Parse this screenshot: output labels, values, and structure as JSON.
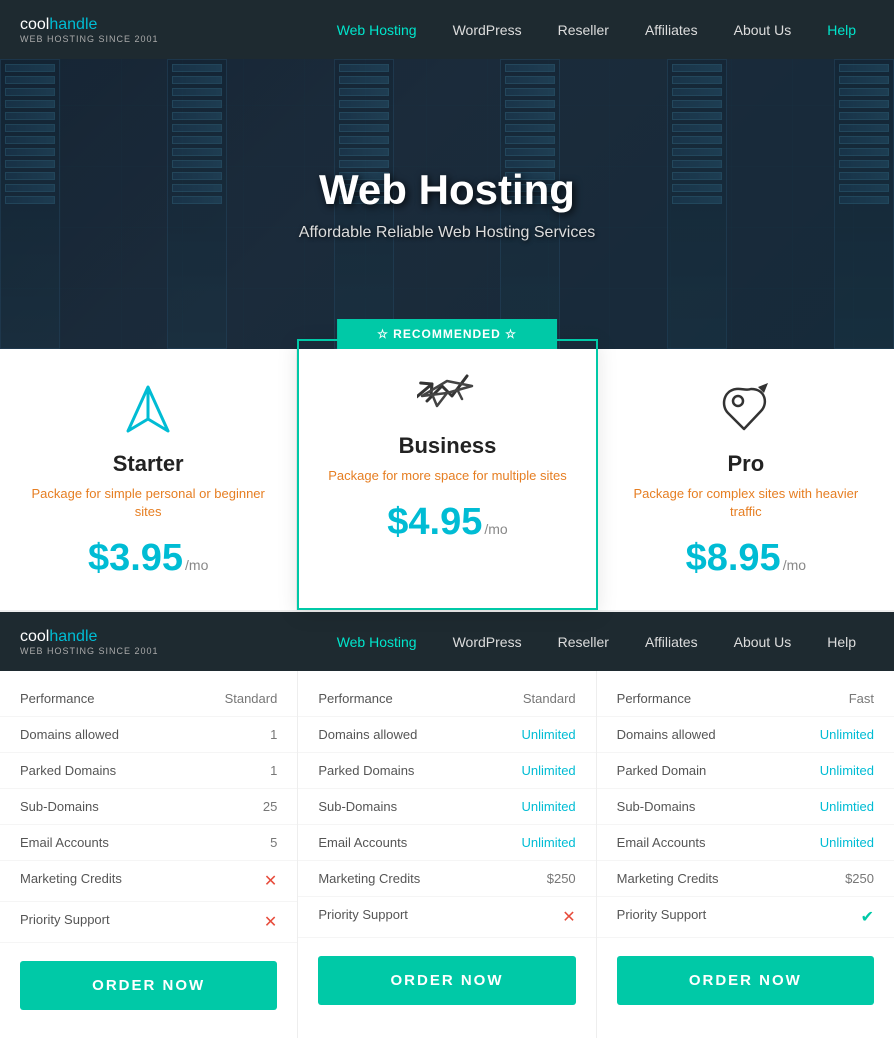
{
  "nav": {
    "logo_cool": "cool",
    "logo_handle": "handle",
    "logo_sub": "WEB HOSTING SINCE 2001",
    "links": [
      {
        "label": "Web Hosting",
        "active": true,
        "help": false
      },
      {
        "label": "WordPress",
        "active": false,
        "help": false
      },
      {
        "label": "Reseller",
        "active": false,
        "help": false
      },
      {
        "label": "Affiliates",
        "active": false,
        "help": false
      },
      {
        "label": "About Us",
        "active": false,
        "help": false
      },
      {
        "label": "Help",
        "active": false,
        "help": true
      }
    ]
  },
  "hero": {
    "title": "Web Hosting",
    "subtitle": "Affordable Reliable Web Hosting Services"
  },
  "recommended_badge": "☆ RECOMMENDED ☆",
  "plans": [
    {
      "id": "starter",
      "name": "Starter",
      "desc": "Package for simple personal\nor beginner sites",
      "price": "$3.95",
      "mo": "/mo",
      "featured": false
    },
    {
      "id": "business",
      "name": "Business",
      "desc": "Package for more space for\nmultiple sites",
      "price": "$4.95",
      "mo": "/mo",
      "featured": true
    },
    {
      "id": "pro",
      "name": "Pro",
      "desc": "Package for complex sites\nwith heavier traffic",
      "price": "$8.95",
      "mo": "/mo",
      "featured": false
    }
  ],
  "features": {
    "starter": [
      {
        "label": "Performance",
        "value": "Standard",
        "type": "normal"
      },
      {
        "label": "Domains allowed",
        "value": "1",
        "type": "normal"
      },
      {
        "label": "Parked Domains",
        "value": "1",
        "type": "normal"
      },
      {
        "label": "Sub-Domains",
        "value": "25",
        "type": "normal"
      },
      {
        "label": "Email Accounts",
        "value": "5",
        "type": "normal"
      },
      {
        "label": "Marketing Credits",
        "value": "✕",
        "type": "cross"
      },
      {
        "label": "Priority Support",
        "value": "✕",
        "type": "cross"
      }
    ],
    "business": [
      {
        "label": "Performance",
        "value": "Standard",
        "type": "normal"
      },
      {
        "label": "Domains allowed",
        "value": "Unlimited",
        "type": "blue"
      },
      {
        "label": "Parked Domains",
        "value": "Unlimited",
        "type": "blue"
      },
      {
        "label": "Sub-Domains",
        "value": "Unlimited",
        "type": "blue"
      },
      {
        "label": "Email Accounts",
        "value": "Unlimited",
        "type": "blue"
      },
      {
        "label": "Marketing Credits",
        "value": "$250",
        "type": "normal"
      },
      {
        "label": "Priority Support",
        "value": "✕",
        "type": "cross"
      }
    ],
    "pro": [
      {
        "label": "Performance",
        "value": "Fast",
        "type": "normal"
      },
      {
        "label": "Domains allowed",
        "value": "Unlimited",
        "type": "blue"
      },
      {
        "label": "Parked Domain",
        "value": "Unlimited",
        "type": "blue"
      },
      {
        "label": "Sub-Domains",
        "value": "Unlimtied",
        "type": "blue"
      },
      {
        "label": "Email Accounts",
        "value": "Unlimited",
        "type": "blue"
      },
      {
        "label": "Marketing Credits",
        "value": "$250",
        "type": "normal"
      },
      {
        "label": "Priority Support",
        "value": "✔",
        "type": "check"
      }
    ]
  },
  "order_btn_label": "ORDER NOW"
}
